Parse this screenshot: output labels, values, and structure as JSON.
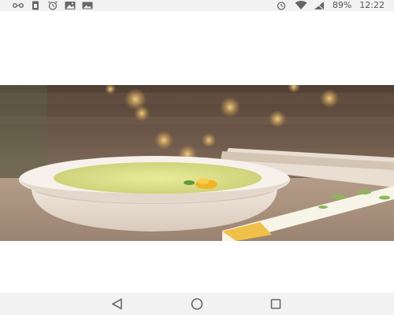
{
  "status_bar": {
    "battery_percent": "89%",
    "time": "12:22",
    "icons": [
      "cast-icon",
      "sim-icon",
      "alarm-icon",
      "image-icon",
      "photo-icon",
      "alarm-icon",
      "wifi-icon",
      "signal-icon"
    ]
  },
  "navigation": {
    "buttons": [
      "back-button",
      "home-button",
      "recents-button"
    ]
  },
  "colors": {
    "status_bar_bg": "#f2f2f2",
    "nav_bar_bg": "#f2f2f2",
    "icon_gray": "#666666"
  }
}
